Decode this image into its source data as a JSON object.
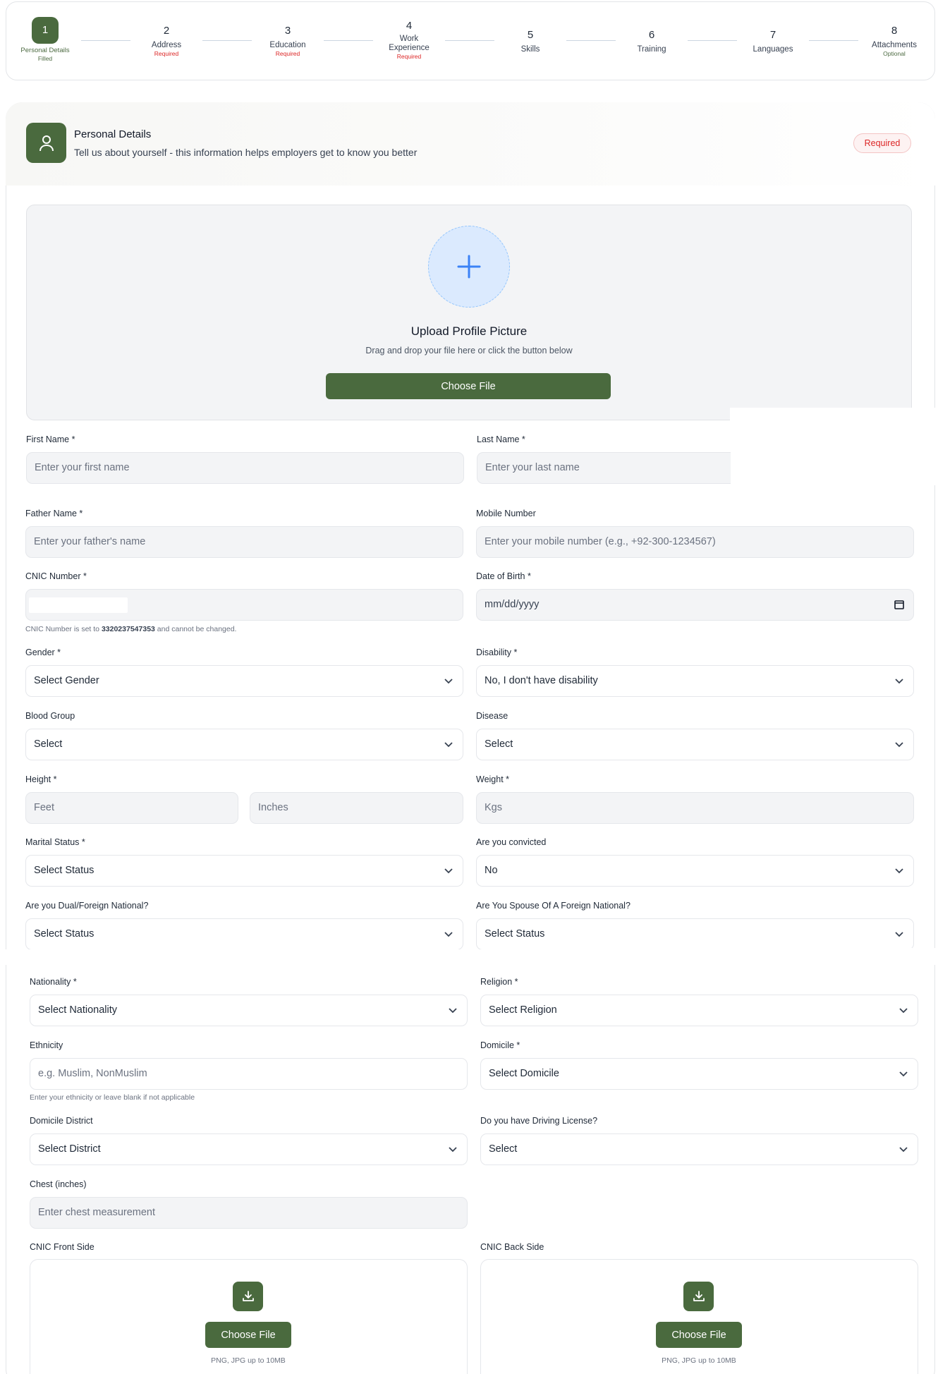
{
  "stepper": {
    "steps": [
      {
        "num": "1",
        "label": "Personal Details",
        "sub": "Filled"
      },
      {
        "num": "2",
        "label": "Address",
        "sub": "Required"
      },
      {
        "num": "3",
        "label": "Education",
        "sub": "Required"
      },
      {
        "num": "4",
        "label_line1": "Work",
        "label_line2": "Experience",
        "sub": "Required"
      },
      {
        "num": "5",
        "label": "Skills"
      },
      {
        "num": "6",
        "label": "Training"
      },
      {
        "num": "7",
        "label": "Languages"
      },
      {
        "num": "8",
        "label": "Attachments",
        "sub": "Optional"
      }
    ]
  },
  "section": {
    "title": "Personal Details",
    "subtitle": "Tell us about yourself - this information helps employers get to know you better",
    "badge": "Required",
    "icon": "user-icon"
  },
  "upload": {
    "title": "Upload Profile Picture",
    "subtitle": "Drag and drop your file here or click the button below",
    "button": "Choose File"
  },
  "form": {
    "first_name": {
      "label": "First Name *",
      "placeholder": "Enter your first name"
    },
    "last_name": {
      "label": "Last Name *",
      "placeholder": "Enter your last name"
    },
    "father_name": {
      "label": "Father Name *",
      "placeholder": "Enter your father's name"
    },
    "mobile": {
      "label": "Mobile Number",
      "placeholder": "Enter your mobile number (e.g., +92-300-1234567)"
    },
    "cnic": {
      "label": "CNIC Number *",
      "help_prefix": "CNIC Number is set to ",
      "help_value": "3320237547353",
      "help_suffix": " and cannot be changed."
    },
    "dob": {
      "label": "Date of Birth *",
      "placeholder": "mm/dd/yyyy"
    },
    "gender": {
      "label": "Gender *",
      "value": "Select Gender"
    },
    "disability": {
      "label": "Disability *",
      "value": "No, I don't have disability"
    },
    "blood_group": {
      "label": "Blood Group",
      "value": "Select"
    },
    "disease": {
      "label": "Disease",
      "value": "Select"
    },
    "height": {
      "label": "Height *",
      "feet_placeholder": "Feet",
      "inches_placeholder": "Inches"
    },
    "weight": {
      "label": "Weight *",
      "placeholder": "Kgs"
    },
    "marital_status": {
      "label": "Marital Status *",
      "value": "Select Status"
    },
    "convicted": {
      "label": "Are you convicted",
      "value": "No"
    },
    "dual_national": {
      "label": "Are you Dual/Foreign National?",
      "value": "Select Status"
    },
    "spouse_foreign": {
      "label": "Are You Spouse Of A Foreign National?",
      "value": "Select Status"
    },
    "nationality": {
      "label": "Nationality *",
      "value": "Select Nationality"
    },
    "religion": {
      "label": "Religion *",
      "value": "Select Religion"
    },
    "ethnicity": {
      "label": "Ethnicity",
      "placeholder": "e.g. Muslim, NonMuslim",
      "help": "Enter your ethnicity or leave blank if not applicable"
    },
    "domicile": {
      "label": "Domicile *",
      "value": "Select Domicile"
    },
    "domicile_district": {
      "label": "Domicile District",
      "value": "Select District"
    },
    "driving_license": {
      "label": "Do you have Driving License?",
      "value": "Select"
    },
    "chest": {
      "label": "Chest (inches)",
      "placeholder": "Enter chest measurement"
    },
    "cnic_front": {
      "label": "CNIC Front Side",
      "button": "Choose File",
      "note": "PNG, JPG up to 10MB"
    },
    "cnic_back": {
      "label": "CNIC Back Side",
      "button": "Choose File",
      "note": "PNG, JPG up to 10MB"
    }
  },
  "colors": {
    "primary": "#4a6a3e",
    "required": "#dc2626",
    "field_bg": "#f3f4f6"
  }
}
